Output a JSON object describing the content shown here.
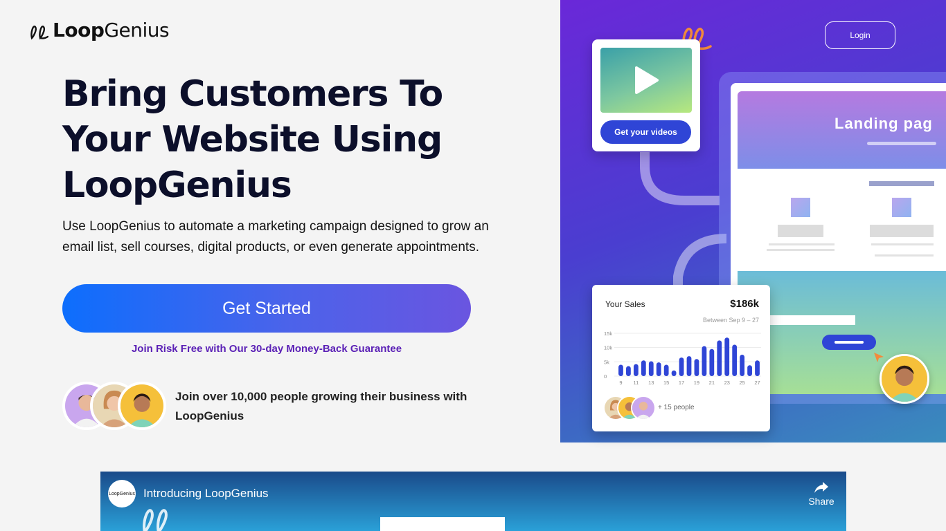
{
  "brand": {
    "name_bold": "Loop",
    "name_regular": "Genius"
  },
  "hero": {
    "headline": "Bring Customers To Your Website Using LoopGenius",
    "subtext": "Use LoopGenius to automate a marketing campaign designed to grow an email list, sell courses, digital products, or even generate appointments.",
    "cta_label": "Get Started",
    "guarantee": "Join Risk Free with Our 30-day Money-Back Guarantee",
    "social_proof": "Join over 10,000 people growing their business with LoopGenius"
  },
  "header": {
    "login_label": "Login"
  },
  "illustration": {
    "video_button": "Get your videos",
    "landing_title": "Landing pag",
    "sales": {
      "title": "Your Sales",
      "total": "$186k",
      "range": "Between Sep 9 – 27",
      "people": "+ 15 people",
      "chart_data": {
        "type": "bar",
        "y_ticks": [
          "15k",
          "10k",
          "5k",
          "0"
        ],
        "x_ticks": [
          "9",
          "11",
          "13",
          "15",
          "17",
          "19",
          "21",
          "23",
          "25",
          "27"
        ],
        "ylim": [
          0,
          15000
        ],
        "values": [
          4000,
          3500,
          4200,
          5500,
          5200,
          4800,
          4000,
          2000,
          6500,
          7000,
          6000,
          10500,
          9500,
          12500,
          13500,
          11000,
          7500,
          3800,
          5500
        ]
      }
    }
  },
  "video_embed": {
    "title": "Introducing LoopGenius",
    "share_label": "Share",
    "channel_logo": "LoopGenius"
  },
  "colors": {
    "accent": "#0d6efd",
    "purple": "#5b21b6",
    "bar": "#2f45d6"
  }
}
